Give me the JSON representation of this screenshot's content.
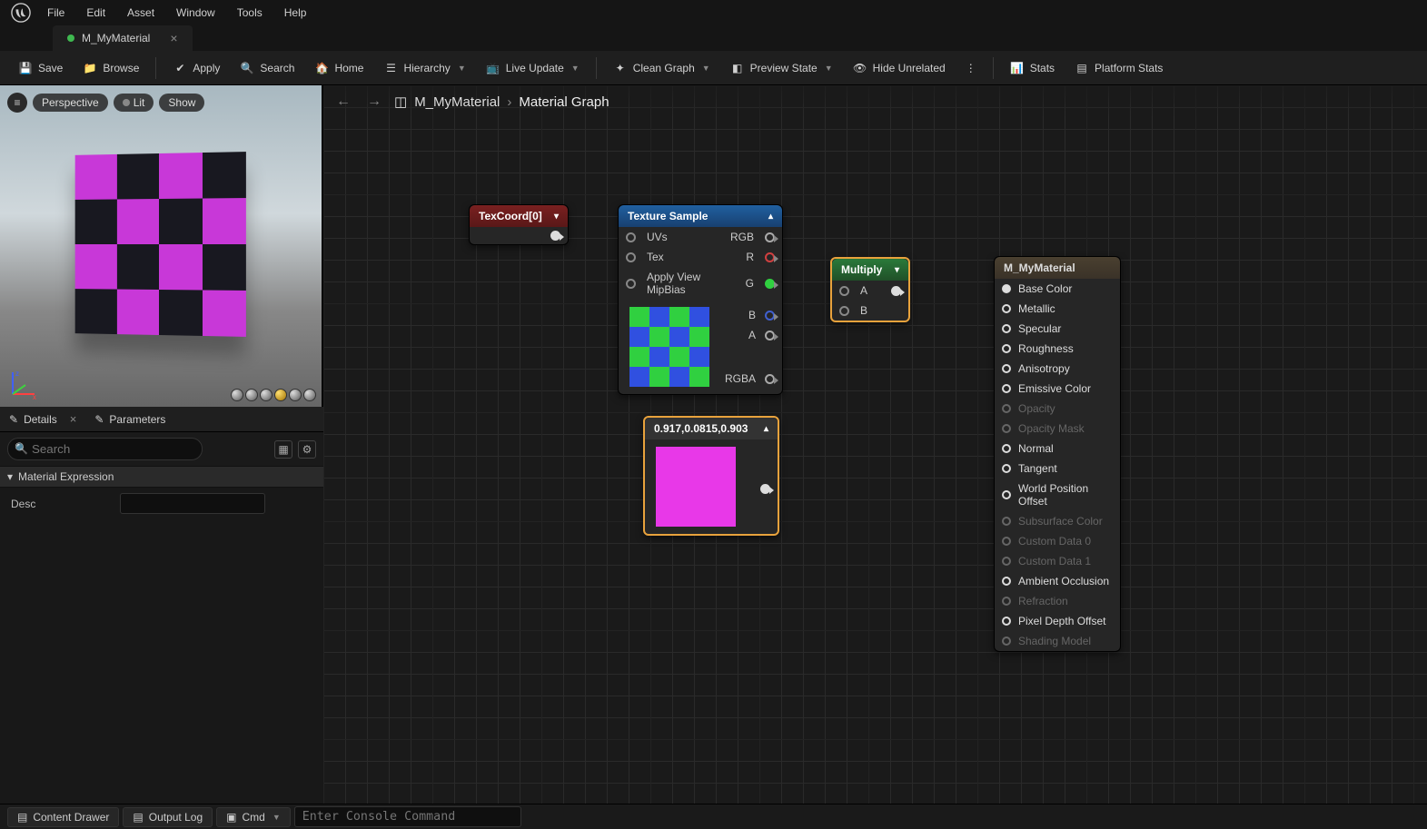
{
  "menubar": [
    "File",
    "Edit",
    "Asset",
    "Window",
    "Tools",
    "Help"
  ],
  "tab": {
    "title": "M_MyMaterial"
  },
  "toolbar": {
    "save": "Save",
    "browse": "Browse",
    "apply": "Apply",
    "search": "Search",
    "home": "Home",
    "hierarchy": "Hierarchy",
    "live_update": "Live Update",
    "clean_graph": "Clean Graph",
    "preview_state": "Preview State",
    "hide_unrelated": "Hide Unrelated",
    "stats": "Stats",
    "platform_stats": "Platform Stats"
  },
  "viewport": {
    "pills": [
      "Perspective",
      "Lit",
      "Show"
    ]
  },
  "left_tabs": {
    "details": "Details",
    "parameters": "Parameters"
  },
  "details": {
    "search_placeholder": "Search",
    "section": "Material Expression",
    "desc_label": "Desc",
    "desc_value": ""
  },
  "breadcrumb": {
    "root": "M_MyMaterial",
    "leaf": "Material Graph"
  },
  "nodes": {
    "texcoord": {
      "title": "TexCoord[0]"
    },
    "texsample": {
      "title": "Texture Sample",
      "in": [
        "UVs",
        "Tex",
        "Apply View MipBias"
      ],
      "out": [
        "RGB",
        "R",
        "G",
        "B",
        "A",
        "RGBA"
      ]
    },
    "multiply": {
      "title": "Multiply",
      "in": [
        "A",
        "B"
      ]
    },
    "const": {
      "title": "0.917,0.0815,0.903",
      "color": "#e838e8"
    },
    "result": {
      "title": "M_MyMaterial",
      "pins": [
        {
          "label": "Base Color",
          "on": true,
          "filled": true
        },
        {
          "label": "Metallic",
          "on": true
        },
        {
          "label": "Specular",
          "on": true
        },
        {
          "label": "Roughness",
          "on": true
        },
        {
          "label": "Anisotropy",
          "on": true
        },
        {
          "label": "Emissive Color",
          "on": true
        },
        {
          "label": "Opacity",
          "on": false
        },
        {
          "label": "Opacity Mask",
          "on": false
        },
        {
          "label": "Normal",
          "on": true
        },
        {
          "label": "Tangent",
          "on": true
        },
        {
          "label": "World Position Offset",
          "on": true
        },
        {
          "label": "Subsurface Color",
          "on": false
        },
        {
          "label": "Custom Data 0",
          "on": false
        },
        {
          "label": "Custom Data 1",
          "on": false
        },
        {
          "label": "Ambient Occlusion",
          "on": true
        },
        {
          "label": "Refraction",
          "on": false
        },
        {
          "label": "Pixel Depth Offset",
          "on": true
        },
        {
          "label": "Shading Model",
          "on": false
        }
      ]
    }
  },
  "statusbar": {
    "content_drawer": "Content Drawer",
    "output_log": "Output Log",
    "cmd": "Cmd",
    "cmd_placeholder": "Enter Console Command"
  }
}
